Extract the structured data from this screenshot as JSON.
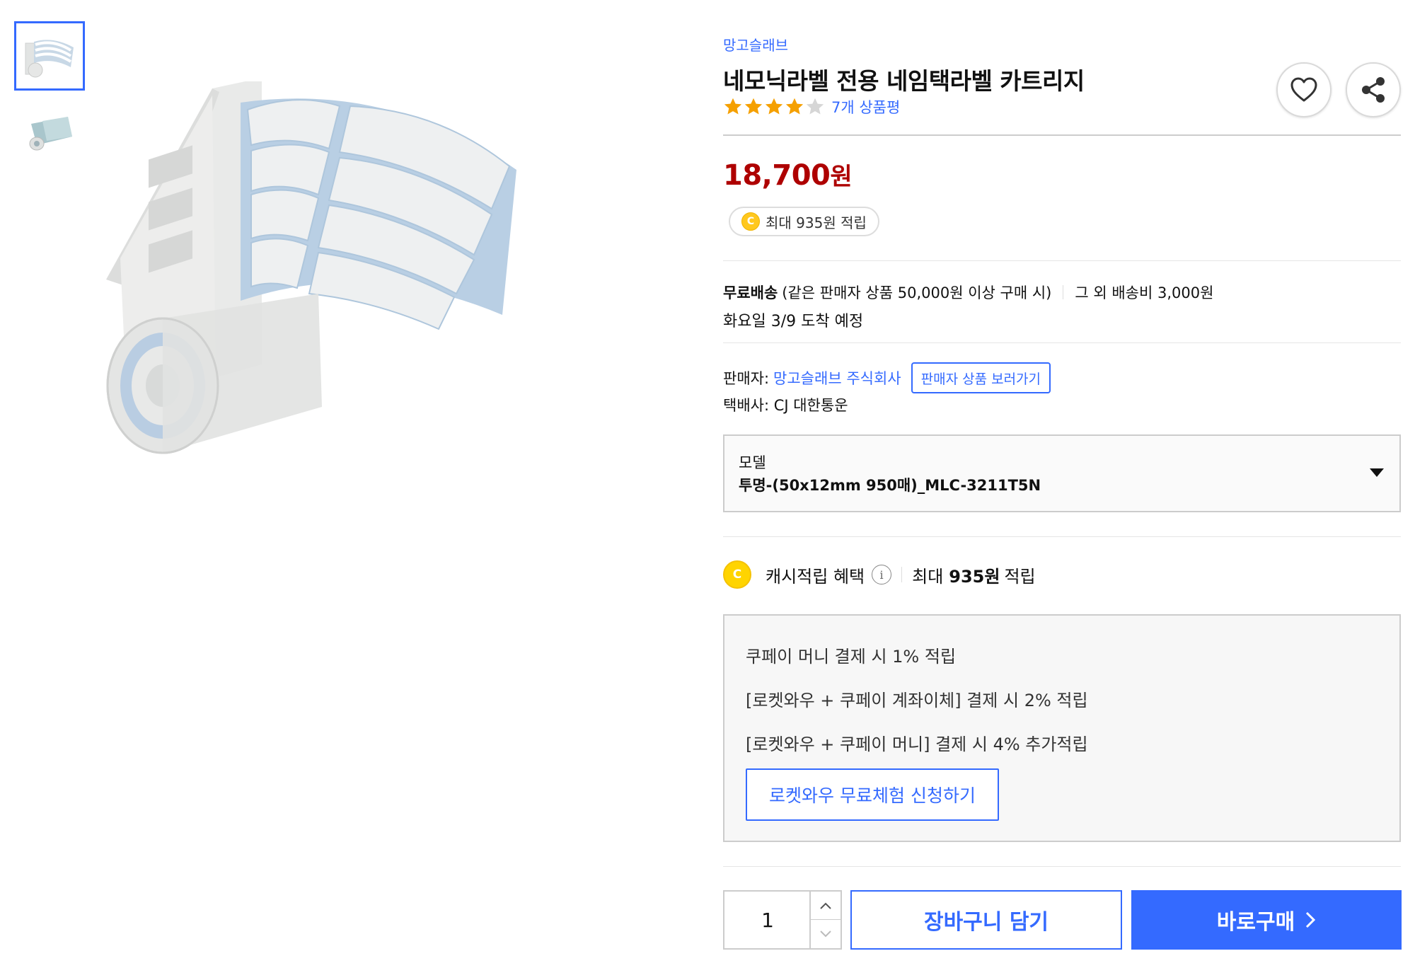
{
  "product": {
    "brand": "망고슬래브",
    "title": "네모닉라벨 전용 네임택라벨 카트리지",
    "rating": 4,
    "rating_max": 5,
    "review_link": "7개 상품평"
  },
  "price": {
    "amount": "18,700",
    "unit": "원"
  },
  "cash_pill": {
    "coin_glyph": "C",
    "text": "최대 935원 적립"
  },
  "shipping": {
    "free_label": "무료배송",
    "free_condition": "(같은 판매자 상품 50,000원 이상 구매 시)",
    "other_fee": "그 외 배송비 3,000원",
    "arrival": "화요일 3/9 도착 예정"
  },
  "seller": {
    "label": "판매자:",
    "name": "망고슬래브 주식회사",
    "view_products": "판매자 상품 보러가기",
    "courier": "택배사: CJ 대한통운"
  },
  "option": {
    "label": "모델",
    "selected": "투명-(50x12mm 950매)_MLC-3211T5N"
  },
  "benefit": {
    "coin_glyph": "C",
    "title": "캐시적립 혜택",
    "info_glyph": "i",
    "max_prefix": "최대",
    "max_amount": "935원",
    "max_suffix": "적립",
    "lines": [
      "쿠페이 머니 결제 시 1% 적립",
      "[로켓와우 + 쿠페이 계좌이체] 결제 시 2% 적립",
      "[로켓와우 + 쿠페이 머니] 결제 시 4% 추가적립"
    ],
    "rocket_button": "로켓와우 무료체험 신청하기"
  },
  "purchase": {
    "quantity": "1",
    "cart_button": "장바구니 담기",
    "buy_button": "바로구매"
  },
  "colors": {
    "accent": "#346aff",
    "price": "#ae0000",
    "star": "#f5a000",
    "coin": "#ffc81e"
  },
  "icons": [
    "heart-icon",
    "share-icon",
    "star-icon",
    "info-icon",
    "caret-down-icon",
    "chevron-up-icon",
    "chevron-down-icon",
    "chevron-right-icon"
  ]
}
